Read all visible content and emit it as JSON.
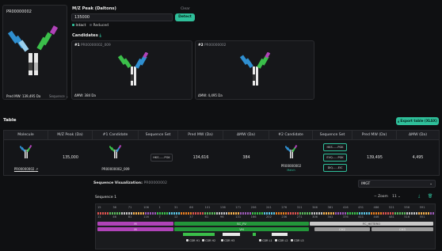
{
  "left_panel": {
    "title": "PR00000002",
    "pred_mw": "Pred MW: 139,495 Da",
    "sequence_label": "Sequence"
  },
  "peak": {
    "label": "M/Z Peak (Daltons)",
    "value": "135000",
    "clear": "Clear",
    "detect": "Detect",
    "intact": "Intact",
    "reduced": "Reduced"
  },
  "candidates": {
    "label": "Candidates",
    "items": [
      {
        "rank": "#1",
        "id": "PR00000002_009",
        "dmw": "ΔMW: 384 Da"
      },
      {
        "rank": "#2",
        "id": "PR00000002",
        "dmw": "ΔMW: 4,495 Da"
      }
    ]
  },
  "table": {
    "title": "Table",
    "export": "Export table (XLSX)",
    "headers": [
      "Molecule",
      "M/Z Peak (Da)",
      "#1 Candidate",
      "Sequence Set",
      "Pred MW (Da)",
      "ΔMW (Da)",
      "#2 Candidate",
      "Sequence Set",
      "Pred MW (Da)",
      "ΔMW (Da)"
    ],
    "row": {
      "molecule": "PR00000002",
      "mz": "135,000",
      "c1": "PR00000002_009",
      "c1_seq": "HKS......PGK",
      "c1_mw": "134,616",
      "c1_dmw": "384",
      "c2": "PR00000002",
      "c2_match": "Match",
      "c2_seqs": [
        "HKS......PGK",
        "EVQ......PGK",
        "DIQ......EIC"
      ],
      "c2_mw": "139,495",
      "c2_dmw": "4,495"
    }
  },
  "seqviz": {
    "title": "Sequence Visualization:",
    "id": "PR00000002",
    "scheme": "IMGT",
    "sequence": "Sequence 1",
    "zoom_label": "Zoom",
    "zoom": "11",
    "ticks": [
      "15",
      "36",
      "71",
      "106",
      "1",
      "31",
      "66",
      "101",
      "136",
      "171",
      "206",
      "241",
      "276",
      "311",
      "346",
      "381",
      "416",
      "451",
      "486",
      "521",
      "556",
      "591"
    ],
    "ticks2": [
      "11",
      "46",
      "81",
      "116",
      "7",
      "12",
      "37",
      "61",
      "96",
      "131",
      "166",
      "202",
      "236",
      "271",
      "306",
      "341",
      "376",
      "411",
      "446",
      "481",
      "516",
      "551"
    ],
    "bars_row1": [
      {
        "label": "M",
        "color": "#b043b8"
      },
      {
        "label": "SC_FV",
        "color": "#23963a"
      },
      {
        "label": "FC_HETERO",
        "color": "#bfbfbf"
      }
    ],
    "bars_row2": [
      {
        "label": "M",
        "color": "#b043b8"
      },
      {
        "label": "VH",
        "color": "#23963a"
      },
      {
        "label": "CH2",
        "color": "#9a9a9a"
      },
      {
        "label": "CH3",
        "color": "#9a9a9a"
      }
    ],
    "cdr_labels": [
      "CDR H1",
      "CDR H2",
      "CDR H3",
      "CDR L1",
      "CDR L2",
      "CDR L3"
    ]
  }
}
